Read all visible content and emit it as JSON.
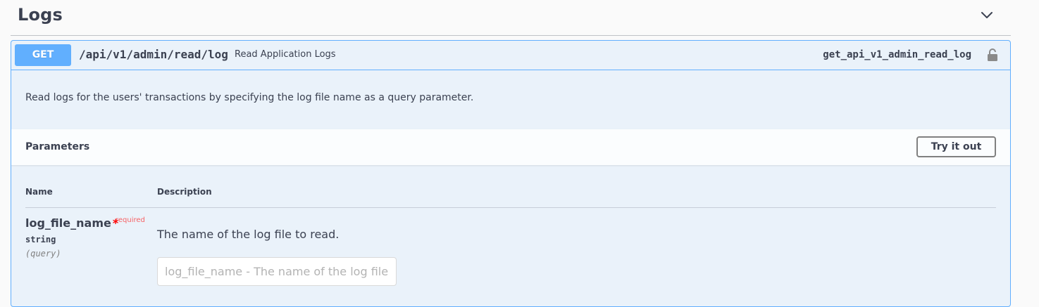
{
  "tag": {
    "title": "Logs",
    "toggle_icon": "chevron-down-icon"
  },
  "operation": {
    "method": "GET",
    "path": "/api/v1/admin/read/log",
    "summary": "Read Application Logs",
    "operation_id": "get_api_v1_admin_read_log",
    "lock_icon": "lock-icon",
    "description": "Read logs for the users' transactions by specifying the log file name as a query parameter."
  },
  "parameters": {
    "section_title": "Parameters",
    "try_button_label": "Try it out",
    "columns": {
      "name": "Name",
      "description": "Description"
    },
    "items": [
      {
        "name": "log_file_name",
        "required_star": "*",
        "required_label": "required",
        "type": "string",
        "location": "(query)",
        "description": "The name of the log file to read.",
        "input_value": "",
        "input_placeholder": "log_file_name - The name of the log file to read."
      }
    ]
  },
  "colors": {
    "get_accent": "#61affe",
    "text": "#3b4151",
    "required": "#ff0000"
  }
}
